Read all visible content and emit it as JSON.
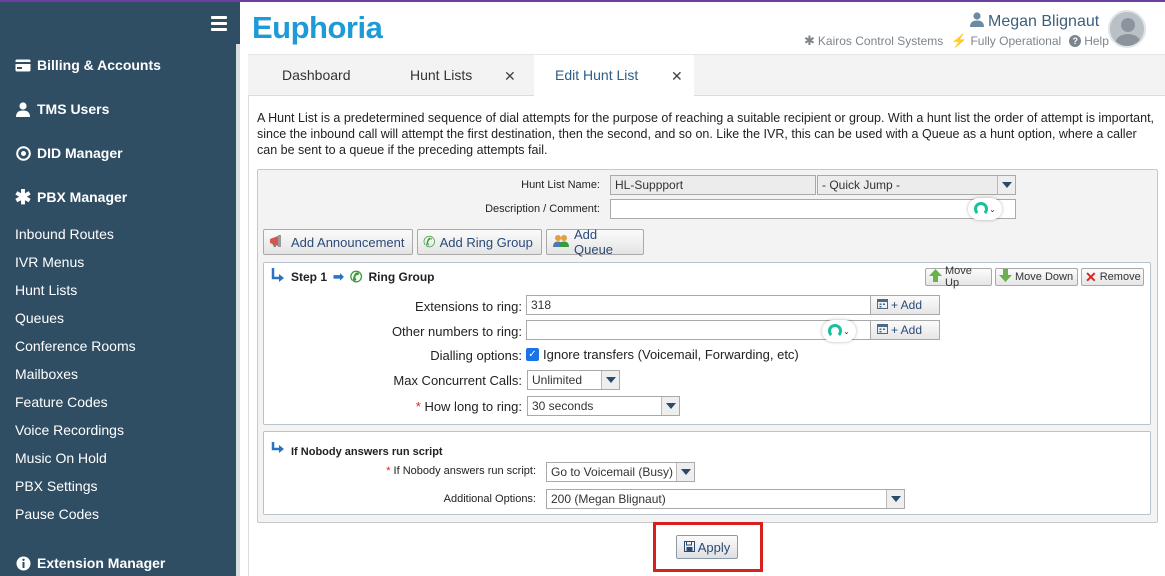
{
  "app": {
    "logo": "Euphoria"
  },
  "header": {
    "user_name": "Megan Blignaut",
    "company": "Kairos Control Systems",
    "status": "Fully Operational",
    "help": "Help"
  },
  "sidebar": {
    "sections": [
      {
        "label": "Billing & Accounts",
        "icon": "billing-icon"
      },
      {
        "label": "TMS Users",
        "icon": "user-icon"
      },
      {
        "label": "DID Manager",
        "icon": "target-icon"
      },
      {
        "label": "PBX Manager",
        "icon": "asterisk-icon"
      }
    ],
    "items": [
      "Inbound Routes",
      "IVR Menus",
      "Hunt Lists",
      "Queues",
      "Conference Rooms",
      "Mailboxes",
      "Feature Codes",
      "Voice Recordings",
      "Music On Hold",
      "PBX Settings",
      "Pause Codes"
    ],
    "bottom_section": {
      "label": "Extension Manager",
      "icon": "info-icon"
    }
  },
  "tabs": [
    {
      "label": "Dashboard",
      "closable": false,
      "active": false
    },
    {
      "label": "Hunt Lists",
      "closable": true,
      "active": false
    },
    {
      "label": "Edit Hunt List",
      "closable": true,
      "active": true
    }
  ],
  "intro": "A Hunt List is a predetermined sequence of dial attempts for the purpose of reaching a suitable recipient or group. With a hunt list the order of attempt is important, since the inbound call will attempt the first destination, then the second, and so on. Like the IVR, this can be used with a Queue as a hunt option, where a caller can be sent to a queue if the preceding attempts fail.",
  "form": {
    "name_label": "Hunt List Name:",
    "name_value": "HL-Suppport",
    "quick_jump": "- Quick Jump -",
    "desc_label": "Description / Comment:",
    "desc_value": "",
    "add_announcement": "Add Announcement",
    "add_ring_group": "Add Ring Group",
    "add_queue": "Add Queue"
  },
  "step1": {
    "step_label": "Step 1",
    "type": "Ring Group",
    "move_up": "Move Up",
    "move_down": "Move Down",
    "remove": "Remove",
    "ext_label": "Extensions to ring:",
    "ext_value": "318",
    "other_label": "Other numbers to ring:",
    "other_value": "",
    "add_label": "+ Add",
    "dialling_label": "Dialling options:",
    "ignore_transfers": "Ignore transfers (Voicemail, Forwarding, etc)",
    "max_label": "Max Concurrent Calls:",
    "max_value": "Unlimited",
    "ring_label": "How long to ring:",
    "ring_value": "30 seconds",
    "required_mark": "*"
  },
  "step2": {
    "title": "If Nobody answers run script",
    "script_label": "If Nobody answers run script:",
    "script_value": "Go to Voicemail (Busy)",
    "additional_label": "Additional Options:",
    "additional_value": "200 (Megan Blignaut)"
  },
  "apply": "Apply"
}
